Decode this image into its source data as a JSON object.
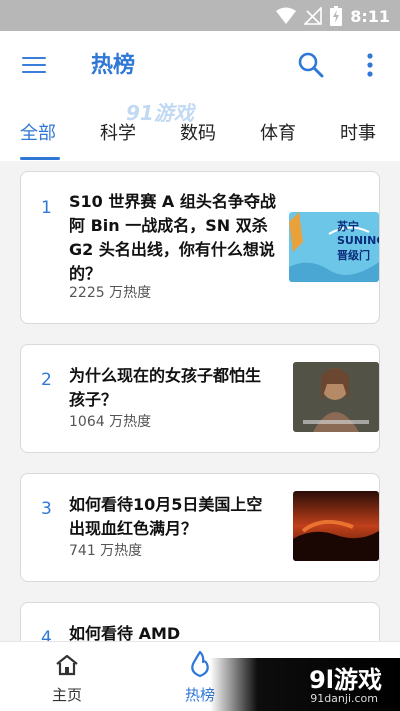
{
  "status": {
    "time": "8:11"
  },
  "header": {
    "title": "热榜"
  },
  "tabs": [
    {
      "label": "全部"
    },
    {
      "label": "科学"
    },
    {
      "label": "数码"
    },
    {
      "label": "体育"
    },
    {
      "label": "时事"
    }
  ],
  "watermark": {
    "top": "91游戏",
    "bottom_main": "9l游戏",
    "bottom_sub": "91danji.com"
  },
  "items": [
    {
      "rank": "1",
      "title": "S10 世界赛 A 组头名争夺战阿 Bin 一战成名，SN 双杀 G2 头名出线，你有什么想说的？",
      "heat": "2225 万热度",
      "thumb_text": "苏宁 SUNING 晋级门"
    },
    {
      "rank": "2",
      "title": "为什么现在的女孩子都怕生孩子？",
      "heat": "1064 万热度"
    },
    {
      "rank": "3",
      "title": "如何看待10月5日美国上空出现血红色满月？",
      "heat": "741 万热度"
    },
    {
      "rank": "4",
      "title": "如何看待 AMD"
    }
  ],
  "bottom_nav": [
    {
      "label": "主页",
      "icon": "home-icon"
    },
    {
      "label": "热榜",
      "icon": "flame-icon"
    }
  ],
  "colors": {
    "accent": "#2f78d6",
    "status_bar": "#b7b7b7"
  }
}
